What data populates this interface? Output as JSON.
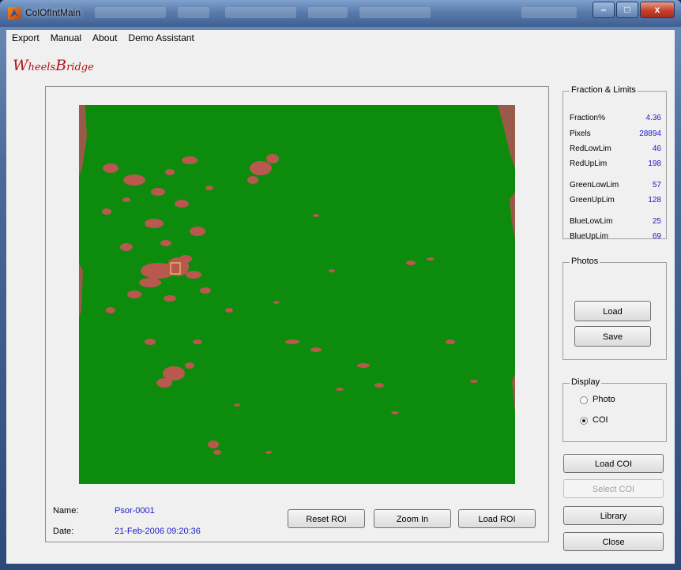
{
  "window": {
    "title": "ColOfIntMain",
    "controls": {
      "minimize": "–",
      "maximize": "□",
      "close": "x"
    }
  },
  "menu": [
    "Export",
    "Manual",
    "About",
    "Demo Assistant"
  ],
  "logo": {
    "first_initial": "W",
    "first_rest": "heels",
    "second_initial": "B",
    "second_rest": "ridge"
  },
  "image_info": {
    "name_label": "Name:",
    "name_value": "Psor-0001",
    "date_label": "Date:",
    "date_value": "21-Feb-2006 09:20:36"
  },
  "image_buttons": {
    "reset_roi": "Reset ROI",
    "zoom_in": "Zoom In",
    "load_roi": "Load ROI"
  },
  "fraction_limits": {
    "title": "Fraction & Limits",
    "rows": [
      {
        "label": "Fraction%",
        "value": "4.36"
      },
      {
        "label": "Pixels",
        "value": "28894"
      },
      {
        "label": "RedLowLim",
        "value": "46"
      },
      {
        "label": "RedUpLim",
        "value": "198"
      },
      {
        "label": "GreenLowLim",
        "value": "57"
      },
      {
        "label": "GreenUpLim",
        "value": "128"
      },
      {
        "label": "BlueLowLim",
        "value": "25"
      },
      {
        "label": "BlueUpLim",
        "value": "69"
      }
    ]
  },
  "photos": {
    "title": "Photos",
    "load": "Load",
    "save": "Save"
  },
  "display": {
    "title": "Display",
    "options": [
      "Photo",
      "COI"
    ],
    "selected": "COI"
  },
  "side_buttons": {
    "load_coi": "Load COI",
    "select_coi": "Select COI",
    "library": "Library",
    "close": "Close"
  },
  "colors": {
    "overlay_green": "#0d8b0d",
    "region_red": "#b8584f",
    "value_blue": "#1a1acc",
    "logo_red": "#b31217"
  }
}
